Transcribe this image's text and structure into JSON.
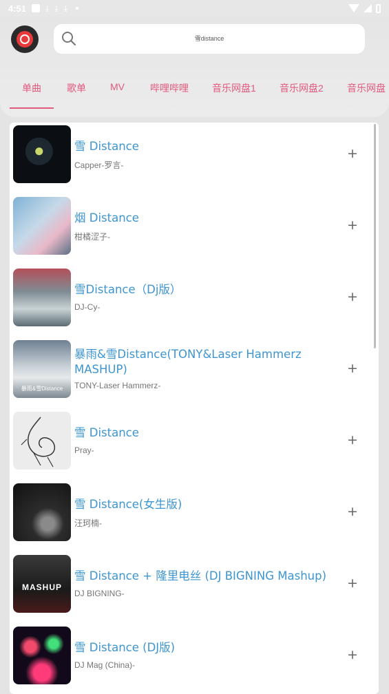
{
  "status": {
    "time": "4:51"
  },
  "search": {
    "query": "雪distance"
  },
  "tabs": [
    "单曲",
    "歌单",
    "MV",
    "哔哩哔哩",
    "音乐网盘1",
    "音乐网盘2",
    "音乐网盘"
  ],
  "songs": [
    {
      "title": "雪 Distance",
      "artist": "Capper-罗言-"
    },
    {
      "title": "烟 Distance",
      "artist": "柑橘涩子-"
    },
    {
      "title": "雪Distance（Dj版）",
      "artist": "DJ-Cy-"
    },
    {
      "title": "暴雨&雪Distance(TONY&Laser Hammerz MASHUP)",
      "artist": "TONY-Laser Hammerz-"
    },
    {
      "title": "雪 Distance",
      "artist": "Pray-"
    },
    {
      "title": "雪 Distance(女生版)",
      "artist": "汪珂楠-"
    },
    {
      "title": "雪 Distance + 隆里电丝 (DJ BIGNING Mashup)",
      "artist": "DJ BIGNING-"
    },
    {
      "title": "雪 Distance (DJ版)",
      "artist": "DJ Mag (China)-"
    }
  ],
  "thumb_texts": {
    "mashup": "MASHUP",
    "distance_caption": "暴雨&雪Distance"
  },
  "add_symbol": "+",
  "colors": {
    "accent": "#e25a7e",
    "title": "#3d95d2",
    "logo": "#e83a3a"
  }
}
